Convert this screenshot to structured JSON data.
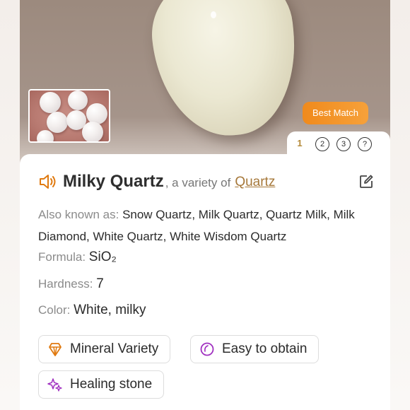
{
  "hero": {
    "badge": "Best Match",
    "pages": [
      "1",
      "2",
      "3",
      "?"
    ],
    "active_page": "1"
  },
  "stone": {
    "name": "Milky Quartz",
    "variety_prefix": ", a variety of",
    "variety_link": "Quartz",
    "aka_label": "Also known as: ",
    "aka_value": "Snow Quartz, Milk Quartz, Quartz Milk, Milk Diamond, White Quartz, White Wisdom Quartz",
    "formula_label": "Formula: ",
    "formula_value": "SiO₂",
    "hardness_label": "Hardness: ",
    "hardness_value": "7",
    "color_label": "Color: ",
    "color_value": "White, milky"
  },
  "tags": [
    {
      "label": "Mineral Variety",
      "icon": "crystal-icon"
    },
    {
      "label": "Easy to obtain",
      "icon": "gem-ring-icon"
    },
    {
      "label": "Healing stone",
      "icon": "sparkles-icon"
    }
  ],
  "colors": {
    "accent": "#f08a1c",
    "link": "#a6783a",
    "chip_icon_orange": "#e07a10",
    "chip_icon_purple": "#a030c0"
  }
}
